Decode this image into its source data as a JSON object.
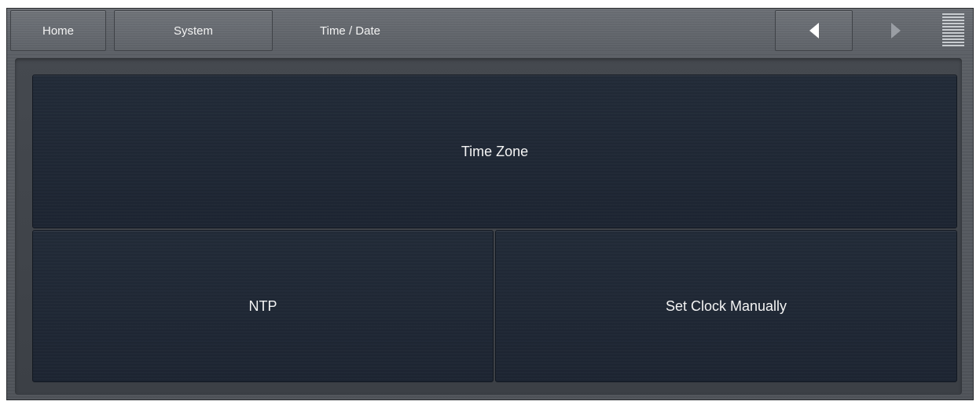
{
  "topbar": {
    "home_label": "Home",
    "system_label": "System",
    "current_page": "Time / Date",
    "back_icon": "triangle-left",
    "forward_icon": "triangle-right",
    "menu_icon": "horizontal-lines-menu"
  },
  "panels": {
    "time_zone_label": "Time Zone",
    "ntp_label": "NTP",
    "set_clock_label": "Set Clock Manually"
  },
  "colors": {
    "panel_bg": "#1f2835",
    "frame_bg": "#5a5e64",
    "text": "#f2f2f2",
    "back_arrow": "#ffffff",
    "forward_arrow_dim": "#9a9ea4"
  }
}
